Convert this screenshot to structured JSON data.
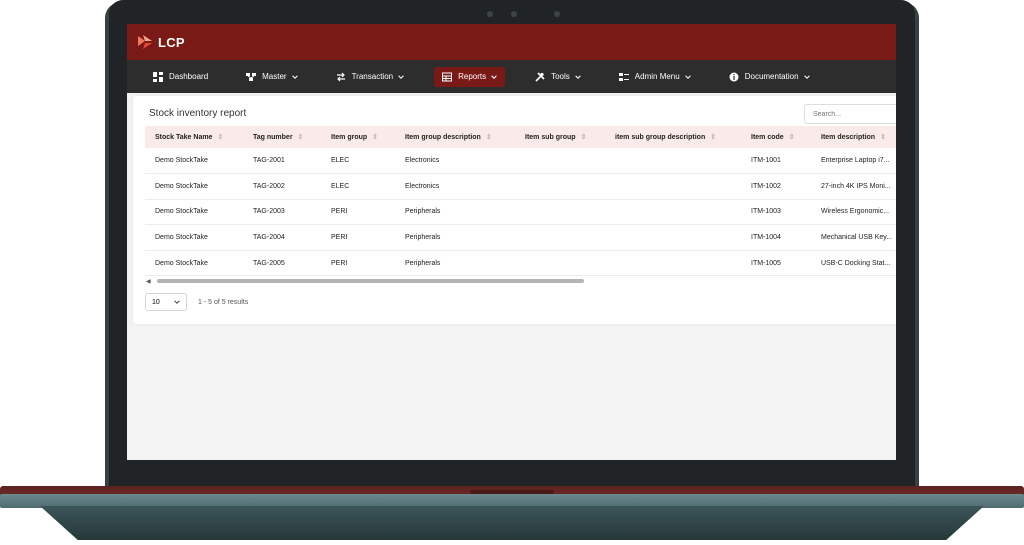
{
  "app": {
    "brand": "LCP"
  },
  "nav": [
    {
      "label": "Dashboard",
      "icon": "dashboard-icon",
      "dropdown": false,
      "active": false
    },
    {
      "label": "Master",
      "icon": "network-icon",
      "dropdown": true,
      "active": false
    },
    {
      "label": "Transaction",
      "icon": "swap-icon",
      "dropdown": true,
      "active": false
    },
    {
      "label": "Reports",
      "icon": "report-icon",
      "dropdown": true,
      "active": true
    },
    {
      "label": "Tools",
      "icon": "tools-icon",
      "dropdown": true,
      "active": false
    },
    {
      "label": "Admin Menu",
      "icon": "admin-icon",
      "dropdown": true,
      "active": false
    },
    {
      "label": "Documentation",
      "icon": "info-icon",
      "dropdown": true,
      "active": false
    }
  ],
  "report": {
    "title": "Stock inventory report",
    "search_placeholder": "Search...",
    "columns": [
      "Stock Take Name",
      "Tag number",
      "Item group",
      "Item group description",
      "Item sub group",
      "item sub group description",
      "Item code",
      "Item description"
    ],
    "rows": [
      [
        "Demo StockTake",
        "TAG-2001",
        "ELEC",
        "Electronics",
        "",
        "",
        "ITM-1001",
        "Enterprise Laptop i7..."
      ],
      [
        "Demo StockTake",
        "TAG-2002",
        "ELEC",
        "Electronics",
        "",
        "",
        "ITM-1002",
        "27-inch 4K IPS Moni..."
      ],
      [
        "Demo StockTake",
        "TAG-2003",
        "PERI",
        "Peripherals",
        "",
        "",
        "ITM-1003",
        "Wireless Ergonomic..."
      ],
      [
        "Demo StockTake",
        "TAG-2004",
        "PERI",
        "Peripherals",
        "",
        "",
        "ITM-1004",
        "Mechanical USB Key..."
      ],
      [
        "Demo StockTake",
        "TAG-2005",
        "PERI",
        "Peripherals",
        "",
        "",
        "ITM-1005",
        "USB-C Docking Stat..."
      ]
    ],
    "page_size": "10",
    "results_text": "1 - 5 of 5 results"
  },
  "colors": {
    "brand": "#7a1a16",
    "navbar": "#2d2d2d",
    "header_row": "#fbeaea"
  }
}
